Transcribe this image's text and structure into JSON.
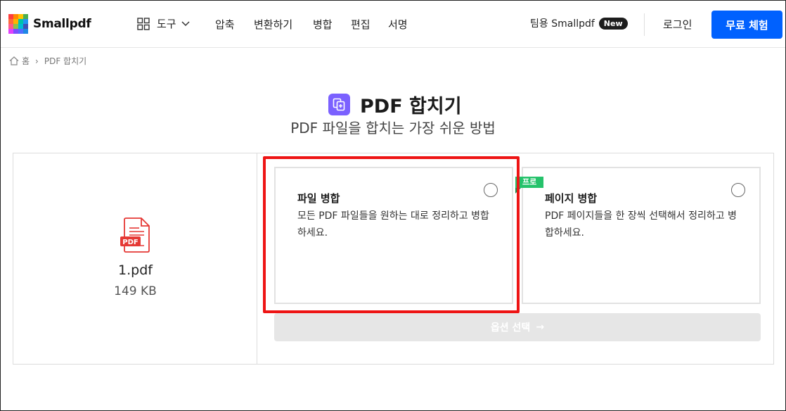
{
  "header": {
    "logo_text": "Smallpdf",
    "tools_label": "도구",
    "nav": [
      "압축",
      "변환하기",
      "병합",
      "편집",
      "서명"
    ],
    "team_label": "팀용 Smallpdf",
    "team_badge": "New",
    "login_label": "로그인",
    "trial_label": "무료 체험"
  },
  "breadcrumb": {
    "home": "홈",
    "current": "PDF 합치기"
  },
  "page": {
    "title": "PDF 합치기",
    "subtitle": "PDF 파일을 합치는 가장 쉬운 방법"
  },
  "file": {
    "icon_label": "PDF",
    "name": "1.pdf",
    "size": "149 KB"
  },
  "options": [
    {
      "title": "파일 병합",
      "description": "모든 PDF 파일들을 원하는 대로 정리하고 병합하세요.",
      "selected": false
    },
    {
      "title": "페이지 병합",
      "description": "PDF 페이지들을 한 장씩 선택해서 정리하고 병합하세요.",
      "badge": "프로",
      "selected": false
    }
  ],
  "action": {
    "label": "옵션 선택",
    "arrow": "→"
  },
  "colors": {
    "brand_blue": "#0061fe",
    "title_icon": "#7b61ff",
    "pro_green": "#25c26b",
    "highlight_red": "#ee1414",
    "pdf_red": "#e53935"
  }
}
